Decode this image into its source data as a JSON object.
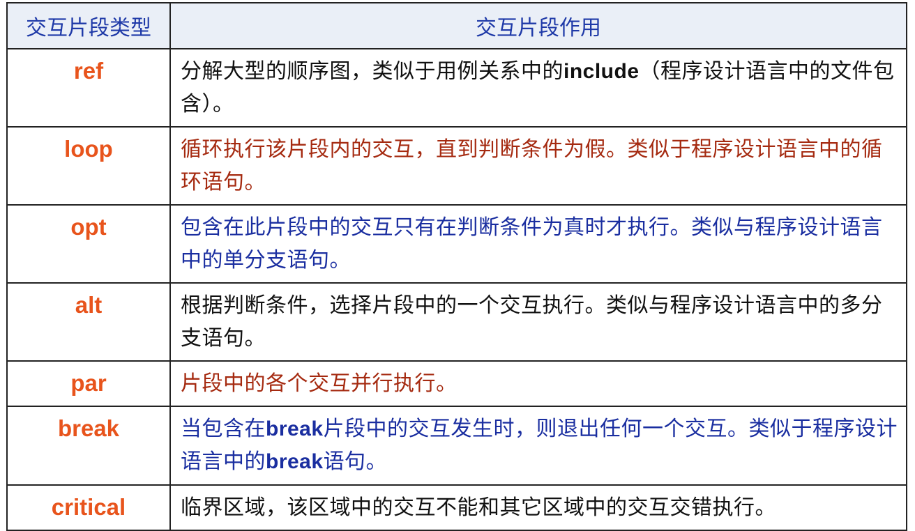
{
  "header": {
    "col1": "交互片段类型",
    "col2": "交互片段作用"
  },
  "rows": [
    {
      "type": "ref",
      "desc_pre": "分解大型的顺序图，类似于用例关系中的",
      "keyword": "include",
      "desc_post": "（程序设计语言中的文件包含）。",
      "color": "#111111"
    },
    {
      "type": "loop",
      "desc": "循环执行该片段内的交互，直到判断条件为假。类似于程序设计语言中的循环语句。",
      "color": "#a52a10"
    },
    {
      "type": "opt",
      "desc": "包含在此片段中的交互只有在判断条件为真时才执行。类似与程序设计语言中的单分支语句。",
      "color": "#1a2ea0"
    },
    {
      "type": "alt",
      "desc": "根据判断条件，选择片段中的一个交互执行。类似与程序设计语言中的多分支语句。",
      "color": "#111111"
    },
    {
      "type": "par",
      "desc": "片段中的各个交互并行执行。",
      "color": "#a52a10"
    },
    {
      "type": "break",
      "desc_pre": "当包含在",
      "keyword": "break",
      "desc_mid": "片段中的交互发生时，则退出任何一个交互。类似于程序设计语言中的",
      "keyword2": "break",
      "desc_post": "语句。",
      "color": "#1a2ea0"
    },
    {
      "type": "critical",
      "desc": "临界区域，该区域中的交互不能和其它区域中的交互交错执行。",
      "color": "#111111"
    }
  ]
}
